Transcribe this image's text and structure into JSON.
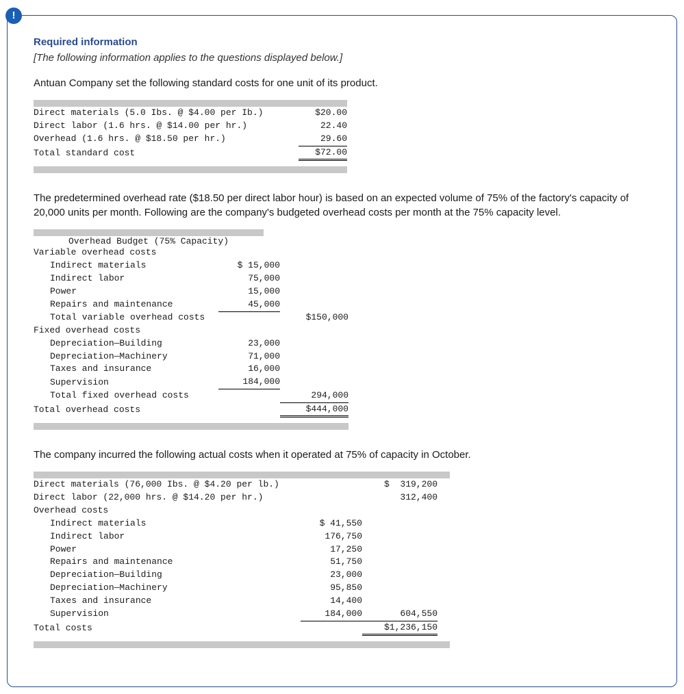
{
  "icon_label": "!",
  "required_title": "Required information",
  "following_text": "[The following information applies to the questions displayed below.]",
  "intro_text": "Antuan Company set the following standard costs for one unit of its product.",
  "std_cost_table": {
    "rows": [
      {
        "label": "Direct materials (5.0 Ibs. @ $4.00 per Ib.)",
        "value": "$20.00"
      },
      {
        "label": "Direct labor (1.6 hrs. @ $14.00 per hr.)",
        "value": "22.40"
      },
      {
        "label": "Overhead (1.6 hrs. @ $18.50 per hr.)",
        "value": "29.60"
      }
    ],
    "total_label": "Total standard cost",
    "total_value": "$72.00"
  },
  "para2": "The predetermined overhead rate ($18.50 per direct labor hour) is based on an expected volume of 75% of the factory's capacity of 20,000 units per month. Following are the company's budgeted overhead costs per month at the 75% capacity level.",
  "oh_budget": {
    "title": "Overhead Budget (75% Capacity)",
    "var_header": "Variable overhead costs",
    "var_rows": [
      {
        "label": "Indirect materials",
        "value": "$ 15,000"
      },
      {
        "label": "Indirect labor",
        "value": "75,000"
      },
      {
        "label": "Power",
        "value": "15,000"
      },
      {
        "label": "Repairs and maintenance",
        "value": "45,000"
      }
    ],
    "var_total_label": "Total variable overhead costs",
    "var_total_value": "$150,000",
    "fixed_header": "Fixed overhead costs",
    "fixed_rows": [
      {
        "label": "Depreciation—Building",
        "value": "23,000"
      },
      {
        "label": "Depreciation—Machinery",
        "value": "71,000"
      },
      {
        "label": "Taxes and insurance",
        "value": "16,000"
      },
      {
        "label": "Supervision",
        "value": "184,000"
      }
    ],
    "fixed_total_label": "Total fixed overhead costs",
    "fixed_total_value": "294,000",
    "grand_total_label": "Total overhead costs",
    "grand_total_value": "$444,000"
  },
  "para3": "The company incurred the following actual costs when it operated at 75% of capacity in October.",
  "actual_costs": {
    "dm": {
      "label": "Direct materials (76,000 Ibs. @ $4.20 per lb.)",
      "value": "$  319,200"
    },
    "dl": {
      "label": "Direct labor (22,000 hrs. @ $14.20 per hr.)",
      "value": "312,400"
    },
    "oh_header": "Overhead costs",
    "oh_rows": [
      {
        "label": "Indirect materials",
        "value": "$ 41,550"
      },
      {
        "label": "Indirect labor",
        "value": "176,750"
      },
      {
        "label": "Power",
        "value": "17,250"
      },
      {
        "label": "Repairs and maintenance",
        "value": "51,750"
      },
      {
        "label": "Depreciation—Building",
        "value": "23,000"
      },
      {
        "label": "Depreciation—Machinery",
        "value": "95,850"
      },
      {
        "label": "Taxes and insurance",
        "value": "14,400"
      },
      {
        "label": "Supervision",
        "value": "184,000"
      }
    ],
    "oh_subtotal": "604,550",
    "total_label": "Total costs",
    "total_value": "$1,236,150"
  }
}
